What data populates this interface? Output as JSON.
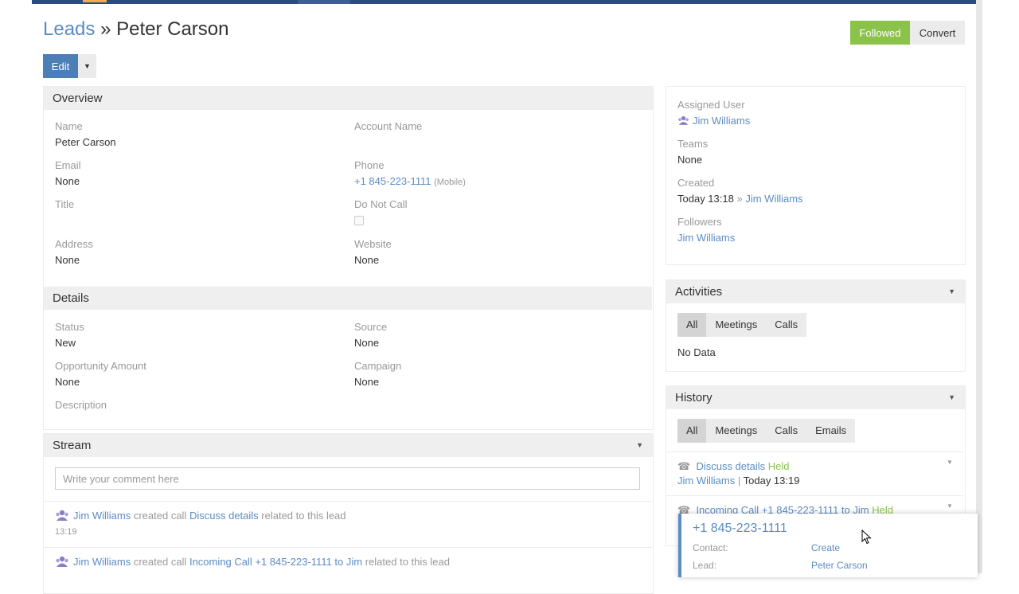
{
  "header": {
    "breadcrumb_root": "Leads",
    "separator": "»",
    "record_name": "Peter Carson",
    "followed_label": "Followed",
    "convert_label": "Convert",
    "edit_label": "Edit"
  },
  "overview": {
    "title": "Overview",
    "name_label": "Name",
    "name_value": "Peter Carson",
    "account_label": "Account Name",
    "email_label": "Email",
    "email_value": "None",
    "phone_label": "Phone",
    "phone_value": "+1 845-223-1111",
    "phone_type": "(Mobile)",
    "title_label": "Title",
    "dnc_label": "Do Not Call",
    "address_label": "Address",
    "address_value": "None",
    "website_label": "Website",
    "website_value": "None"
  },
  "details": {
    "title": "Details",
    "status_label": "Status",
    "status_value": "New",
    "source_label": "Source",
    "source_value": "None",
    "opp_label": "Opportunity Amount",
    "opp_value": "None",
    "campaign_label": "Campaign",
    "campaign_value": "None",
    "description_label": "Description"
  },
  "stream": {
    "title": "Stream",
    "comment_placeholder": "Write your comment here",
    "items": [
      {
        "user": "Jim Williams",
        "action": "created call",
        "subject": "Discuss details",
        "suffix": "related to this lead",
        "time": "13:19"
      },
      {
        "user": "Jim Williams",
        "action": "created call",
        "subject": "Incoming Call +1 845-223-1111 to Jim",
        "suffix": "related to this lead"
      }
    ]
  },
  "side": {
    "assigned_label": "Assigned User",
    "assigned_value": "Jim Williams",
    "teams_label": "Teams",
    "teams_value": "None",
    "created_label": "Created",
    "created_time": "Today 13:18",
    "created_sep": "»",
    "created_user": "Jim Williams",
    "followers_label": "Followers",
    "followers_value": "Jim Williams"
  },
  "activities": {
    "title": "Activities",
    "tabs": [
      "All",
      "Meetings",
      "Calls"
    ],
    "empty": "No Data"
  },
  "history": {
    "title": "History",
    "tabs": [
      "All",
      "Meetings",
      "Calls",
      "Emails"
    ],
    "items": [
      {
        "subject": "Discuss details",
        "status": "Held",
        "user": "Jim Williams",
        "time": "Today 13:19"
      },
      {
        "subject": "Incoming Call +1 845-223-1111 to Jim",
        "status": "Held"
      }
    ]
  },
  "popup": {
    "phone": "+1 845-223-1111",
    "contact_label": "Contact:",
    "contact_value": "Create",
    "lead_label": "Lead:",
    "lead_value": "Peter Carson"
  },
  "icons": {
    "user": "user-icon",
    "phone": "phone-icon",
    "caret": "caret-down-icon"
  },
  "colors": {
    "accent_blue": "#5b8cc3",
    "green": "#8bc34a",
    "edit_blue": "#4d7fb7",
    "topbar": "#2a4c7d"
  }
}
